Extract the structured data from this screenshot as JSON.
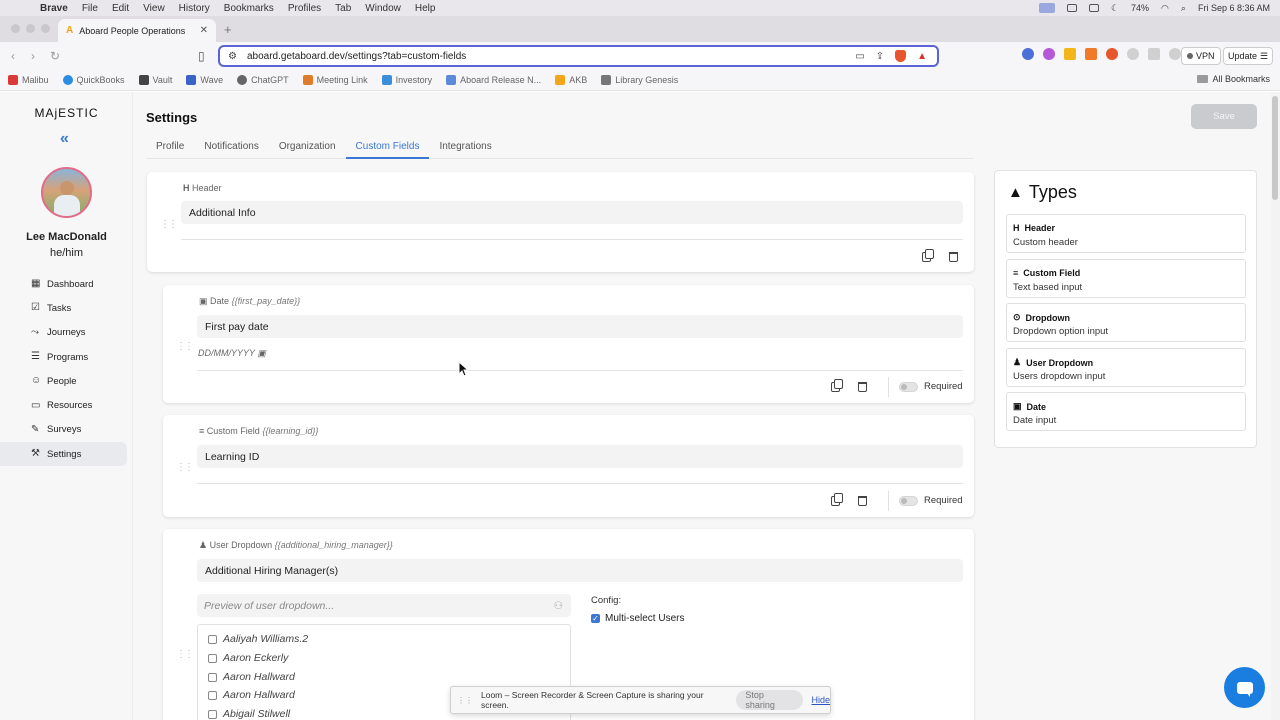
{
  "os_menubar": {
    "app_name": "Brave",
    "items": [
      "File",
      "Edit",
      "View",
      "History",
      "Bookmarks",
      "Profiles",
      "Tab",
      "Window",
      "Help"
    ],
    "battery": "74%",
    "datetime": "Fri Sep 6  8:36 AM"
  },
  "browser": {
    "tab_title": "Aboard People Operations",
    "url": "aboard.getaboard.dev/settings?tab=custom-fields",
    "vpn_label": "VPN",
    "update_label": "Update",
    "bookmarks": [
      "Malibu",
      "QuickBooks",
      "Vault",
      "Wave",
      "ChatGPT",
      "Meeting Link",
      "Investory",
      "Aboard Release N...",
      "AKB",
      "Library Genesis"
    ],
    "all_bookmarks": "All Bookmarks"
  },
  "sidebar": {
    "brand": "MAjESTIC",
    "user_name": "Lee MacDonald",
    "pronouns": "he/him",
    "nav": [
      {
        "label": "Dashboard",
        "icon": "dashboard-icon"
      },
      {
        "label": "Tasks",
        "icon": "checkbox-icon"
      },
      {
        "label": "Journeys",
        "icon": "route-icon"
      },
      {
        "label": "Programs",
        "icon": "list-icon"
      },
      {
        "label": "People",
        "icon": "people-icon"
      },
      {
        "label": "Resources",
        "icon": "folder-icon"
      },
      {
        "label": "Surveys",
        "icon": "survey-icon"
      },
      {
        "label": "Settings",
        "icon": "wrench-icon"
      }
    ],
    "active_index": 7
  },
  "main": {
    "title": "Settings",
    "save_label": "Save",
    "tabs": [
      "Profile",
      "Notifications",
      "Organization",
      "Custom Fields",
      "Integrations"
    ],
    "active_tab": "Custom Fields"
  },
  "cards": {
    "header": {
      "type": "Header",
      "value": "Additional Info"
    },
    "date": {
      "type": "Date",
      "key": "{{first_pay_date}}",
      "value": "First pay date",
      "hint": "DD/MM/YYYY",
      "required_label": "Required"
    },
    "custom": {
      "type": "Custom Field",
      "key": "{{learning_id}}",
      "value": "Learning ID",
      "required_label": "Required"
    },
    "userdd": {
      "type": "User Dropdown",
      "key": "{{additional_hiring_manager}}",
      "value": "Additional Hiring Manager(s)",
      "preview_placeholder": "Preview of user dropdown...",
      "users": [
        "Aaliyah Williams.2",
        "Aaron Eckerly",
        "Aaron Hallward",
        "Aaron Hallward",
        "Abigail Stilwell"
      ],
      "config_label": "Config:",
      "multi_select_label": "Multi-select Users",
      "multi_select_checked": true
    }
  },
  "types_panel": {
    "title": "Types",
    "items": [
      {
        "name": "Header",
        "desc": "Custom header",
        "icon": "header-icon"
      },
      {
        "name": "Custom Field",
        "desc": "Text based input",
        "icon": "text-icon"
      },
      {
        "name": "Dropdown",
        "desc": "Dropdown option input",
        "icon": "dropdown-icon"
      },
      {
        "name": "User Dropdown",
        "desc": "Users dropdown input",
        "icon": "user-icon"
      },
      {
        "name": "Date",
        "desc": "Date input",
        "icon": "calendar-icon"
      }
    ]
  },
  "loom": {
    "message": "Loom – Screen Recorder & Screen Capture is sharing your screen.",
    "stop_label": "Stop sharing",
    "hide_label": "Hide"
  },
  "colors": {
    "accent": "#3b78d6",
    "chat": "#1a7ee0",
    "save_disabled": "#c9cbcf"
  }
}
